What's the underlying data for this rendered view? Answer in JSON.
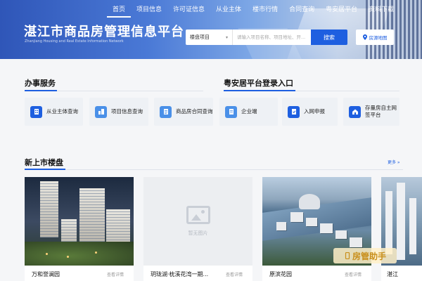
{
  "nav": {
    "items": [
      "首页",
      "项目信息",
      "许可证信息",
      "从业主体",
      "楼市行情",
      "合同查询",
      "粤安居平台",
      "资料下载"
    ],
    "active_index": 0
  },
  "header": {
    "title": "湛江市商品房管理信息平台",
    "subtitle": "Zhanjiang Housing and Real Estate Information Network"
  },
  "search": {
    "select_value": "楼盘项目",
    "placeholder": "请输入项目名称、项目地址、开...",
    "button_label": "搜索",
    "map_button_label": "房源地图"
  },
  "services": {
    "title": "办事服务",
    "items": [
      {
        "label": "从业主体查询",
        "icon": "building-icon"
      },
      {
        "label": "项目信息查询",
        "icon": "project-icon"
      },
      {
        "label": "商品房合同查询",
        "icon": "contract-icon"
      }
    ]
  },
  "yueanju": {
    "title": "粤安居平台登录入口",
    "items": [
      {
        "label": "企业端",
        "icon": "enterprise-icon"
      },
      {
        "label": "入网申报",
        "icon": "declare-icon"
      },
      {
        "label": "存量房自主网签平台",
        "icon": "house-sign-icon"
      }
    ]
  },
  "listings": {
    "title": "新上市楼盘",
    "more_label": "更多 »",
    "no_image_text": "暂无图片",
    "detail_label": "查看详情",
    "items": [
      {
        "name": "万和誉澜园",
        "has_image": true
      },
      {
        "name": "玥珑湖·枕溪花湾一期...",
        "has_image": false
      },
      {
        "name": "原滨花园",
        "has_image": true
      },
      {
        "name": "湛江",
        "has_image": true
      }
    ]
  },
  "watermark": {
    "text": "房管助手"
  },
  "colors": {
    "accent": "#1e5fe0",
    "card_bg": "#eef1f5",
    "page_bg": "#f5f6f8"
  }
}
